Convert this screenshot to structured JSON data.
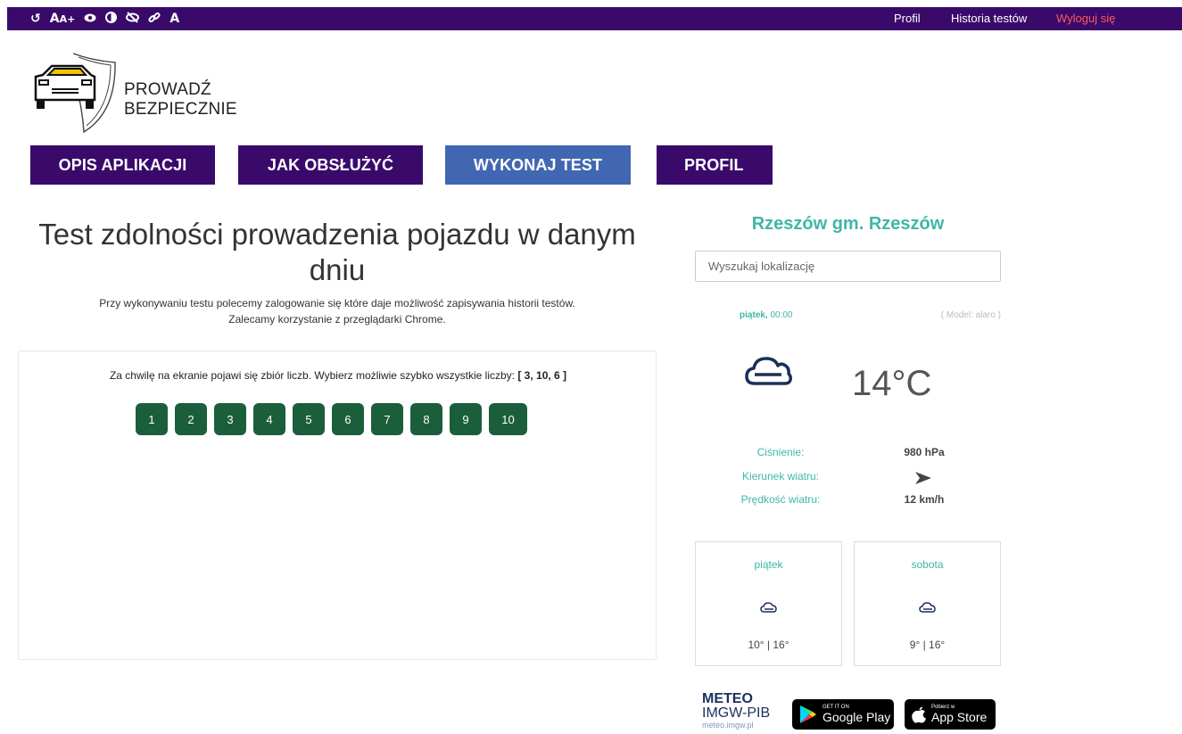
{
  "accessibility": {
    "reset": "↺",
    "font_size": "A",
    "font_size_plus": "A+",
    "eye": "👁",
    "contrast": "◐",
    "hide": "🚫",
    "links": "🔗",
    "font": "A"
  },
  "top_nav": {
    "profile": "Profil",
    "history": "Historia testów",
    "logout": "Wyloguj się"
  },
  "logo": {
    "line1": "PROWADŹ",
    "line2": "BEZPIECZNIE"
  },
  "main_nav": [
    {
      "label": "OPIS APLIKACJI"
    },
    {
      "label": "JAK OBSŁUŻYĆ"
    },
    {
      "label": "WYKONAJ TEST"
    },
    {
      "label": "PROFIL"
    }
  ],
  "colors": {
    "brand": "#3a0a6b",
    "nav_active": "#4267b2",
    "number_button": "#1b5e3b",
    "weather_accent": "#3fb6a8",
    "logout": "#ff5a5a"
  },
  "main": {
    "title": "Test zdolności prowadzenia pojazdu w danym dniu",
    "subtitle_line1": "Przy wykonywaniu testu polecemy zalogowanie się które daje możliwość zapisywania historii testów.",
    "subtitle_line2": "Zalecamy korzystanie z przeglądarki Chrome.",
    "instruction": "Za chwilę na ekranie pojawi się zbiór liczb. Wybierz możliwie szybko wszystkie liczby:",
    "target_numbers": "[ 3, 10, 6 ]",
    "numbers": [
      "1",
      "2",
      "3",
      "4",
      "5",
      "6",
      "7",
      "8",
      "9",
      "10"
    ]
  },
  "weather": {
    "location": "Rzeszów gm. Rzeszów",
    "search_placeholder": "Wyszukaj lokalizację",
    "day": "piątek,",
    "time": "00:00",
    "model": "( Model: alaro )",
    "current_icon": "cloud-icon",
    "temperature": "14°C",
    "pressure_label": "Ciśnienie:",
    "pressure_value": "980 hPa",
    "wind_dir_label": "Kierunek wiatru:",
    "wind_dir_icon": "arrow-right-icon",
    "wind_speed_label": "Prędkość wiatru:",
    "wind_speed_value": "12 km/h",
    "forecast": [
      {
        "day": "piątek",
        "icon": "cloud-icon",
        "temps": "10° | 16°"
      },
      {
        "day": "sobota",
        "icon": "cloud-icon",
        "temps": "9° | 16°"
      }
    ],
    "meteo_line1": "METEO",
    "meteo_line2": "IMGW-PIB",
    "meteo_line3": "meteo.imgw.pl",
    "google_small": "GET IT ON",
    "google_big": "Google Play",
    "apple_small": "Pobierz w",
    "apple_big": "App Store"
  }
}
